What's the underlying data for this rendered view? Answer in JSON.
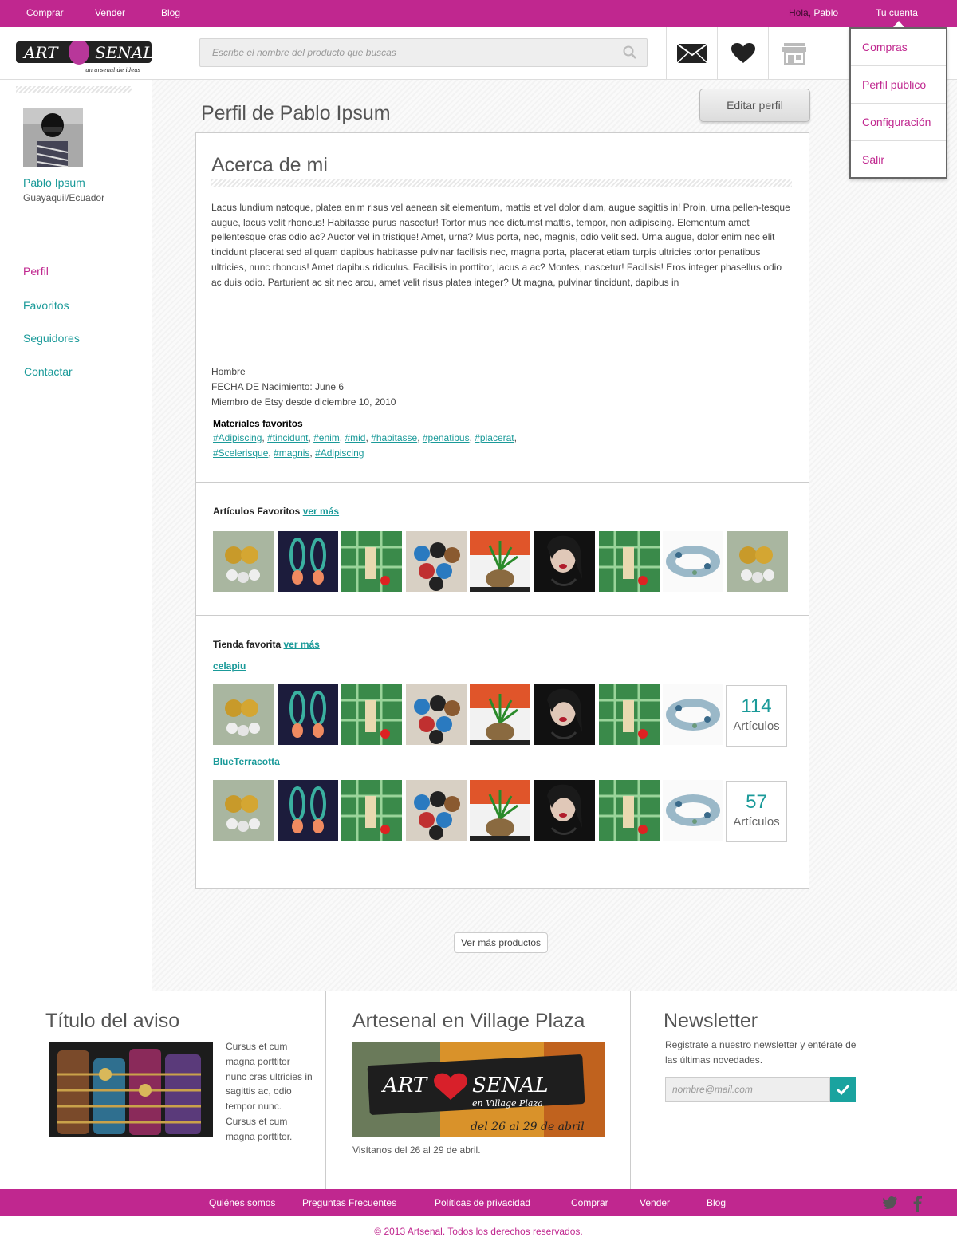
{
  "topbar": {
    "nav": [
      "Comprar",
      "Vender",
      "Blog"
    ],
    "greeting_hola": "Hola,",
    "greeting_name": "Pablo",
    "account": "Tu cuenta"
  },
  "header": {
    "logo_text": "ART SENAL",
    "logo_tagline": "un arsenal de ideas",
    "search_placeholder": "Escribe el nombre del producto que buscas",
    "icons": [
      "mail-icon",
      "heart-icon",
      "store-icon"
    ]
  },
  "dropdown": {
    "items": [
      "Compras",
      "Perfil público",
      "Configuración",
      "Salir"
    ]
  },
  "sidebar": {
    "user_name": "Pablo Ipsum",
    "location": "Guayaquil/Ecuador",
    "nav": [
      "Perfil",
      "Favoritos",
      "Seguidores",
      "Contactar"
    ],
    "active": "Perfil"
  },
  "profile": {
    "title": "Perfil de Pablo Ipsum",
    "edit_button": "Editar perfil",
    "about_heading": "Acerca de mi",
    "about_text": "Lacus lundium natoque, platea enim risus vel aenean sit elementum, mattis et vel dolor diam, augue sagittis in! Proin, urna pellen-tesque augue, lacus velit rhoncus! Habitasse purus nascetur! Tortor mus nec dictumst mattis, tempor, non adipiscing. Elementum amet pellentesque cras odio ac? Auctor vel in tristique! Amet, urna? Mus porta, nec, magnis, odio velit sed. Urna augue, dolor enim nec elit tincidunt placerat sed aliquam dapibus habitasse pulvinar facilisis nec, magna porta, placerat etiam turpis ultricies tortor penatibus ultricies, nunc rhoncus! Amet dapibus ridiculus. Facilisis in porttitor, lacus a ac? Montes, nascetur! Facilisis! Eros integer phasellus odio ac duis odio. Parturient ac sit nec arcu, amet velit risus platea integer? Ut magna, pulvinar tincidunt, dapibus in",
    "gender": "Hombre",
    "birth": "FECHA DE Nacimiento: June 6",
    "member_since": "Miembro de Etsy desde diciembre 10, 2010",
    "materials_heading": "Materiales favoritos",
    "materials": [
      "#Adipiscing",
      "#tincidunt",
      "#enim",
      "#mid",
      "#habitasse",
      "#penatibus",
      "#placerat",
      "#Scelerisque",
      "#magnis",
      "#Adipiscing"
    ]
  },
  "favorites": {
    "heading": "Artículos Favoritos",
    "more": "ver más"
  },
  "shops": {
    "heading": "Tienda favorita",
    "more": "ver más",
    "list": [
      {
        "name": "celapiu",
        "count": "114",
        "count_label": "Artículos"
      },
      {
        "name": "BlueTerracotta",
        "count": "57",
        "count_label": "Artículos"
      }
    ]
  },
  "more_products": "Ver más productos",
  "footer": {
    "ad_title": "Título del aviso",
    "ad_text": "Cursus et cum magna porttitor nunc cras ultricies in sagittis ac, odio tempor nunc. Cursus et cum magna porttitor.",
    "event_title": "Artesenal en Village Plaza",
    "event_banner_line1": "ART SENAL",
    "event_banner_line2": "en Village Plaza",
    "event_banner_line3": "del 26 al 29 de abril",
    "event_text": "Visítanos del 26 al 29 de abril.",
    "newsletter_title": "Newsletter",
    "newsletter_text": "Registrate a nuestro newsletter y entérate de las últimas novedades.",
    "newsletter_placeholder": "nombre@mail.com"
  },
  "bottombar": {
    "links": [
      "Quiénes somos",
      "Preguntas Frecuentes",
      "Políticas de privacidad",
      "Comprar",
      "Vender",
      "Blog"
    ],
    "social": [
      "twitter-icon",
      "facebook-icon"
    ]
  },
  "copyright": "© 2013 Artsenal. Todos los derechos reservados.",
  "colors": {
    "brand": "#c0278f",
    "accent": "#1a9a99"
  }
}
